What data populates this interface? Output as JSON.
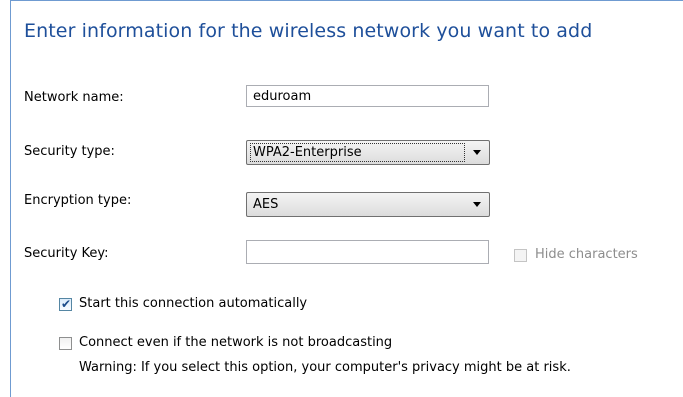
{
  "heading": "Enter information for the wireless network you want to add",
  "form": {
    "network_name_label": "Network name:",
    "network_name_value": "eduroam",
    "security_type_label": "Security type:",
    "security_type_value": "WPA2-Enterprise",
    "encryption_type_label": "Encryption type:",
    "encryption_type_value": "AES",
    "security_key_label": "Security Key:",
    "security_key_value": "",
    "hide_characters_label": "Hide characters"
  },
  "options": {
    "auto_start_label": "Start this connection automatically",
    "auto_start_checked": true,
    "connect_not_broadcasting_label": "Connect even if the network is not broadcasting",
    "connect_not_broadcasting_checked": false,
    "warning_text": "Warning: If you select this option, your computer's privacy might be at risk."
  },
  "colors": {
    "heading": "#1e4f9a",
    "border_accent": "#6f9bd1"
  }
}
